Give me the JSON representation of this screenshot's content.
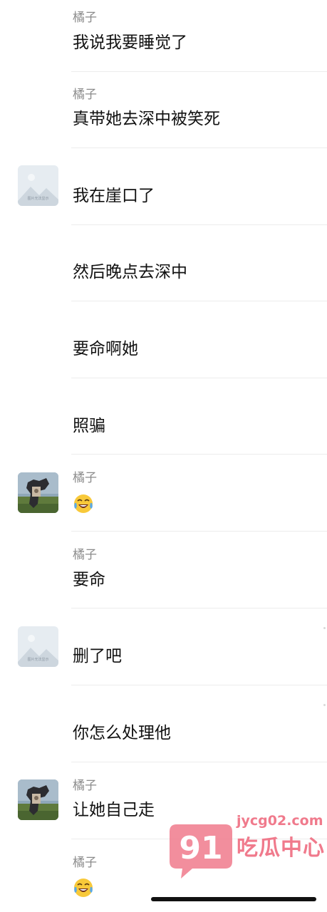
{
  "messages": [
    {
      "sender": "橘子",
      "text": "我说我要睡觉了"
    },
    {
      "sender": "橘子",
      "text": "真带她去深中被笑死"
    },
    {
      "sender": "",
      "text": "我在崖口了",
      "avatar_caption": "图片无法显示"
    },
    {
      "sender": "",
      "text": "然后晚点去深中"
    },
    {
      "sender": "",
      "text": "要命啊她"
    },
    {
      "sender": "",
      "text": "照骗"
    },
    {
      "sender": "橘子",
      "emoji": "crying-laughing-face-icon"
    },
    {
      "sender": "橘子",
      "text": "要命"
    },
    {
      "sender": "",
      "text": "删了吧",
      "avatar_caption": "图片无法显示"
    },
    {
      "sender": "",
      "text": "你怎么处理他"
    },
    {
      "sender": "橘子",
      "text": "让她自己走"
    },
    {
      "sender": "橘子",
      "emoji": "crying-laughing-face-icon"
    }
  ],
  "watermark": {
    "number": "91",
    "domain": "jycg02.com",
    "brand": "吃瓜中心",
    "color": "#f07a8c"
  }
}
